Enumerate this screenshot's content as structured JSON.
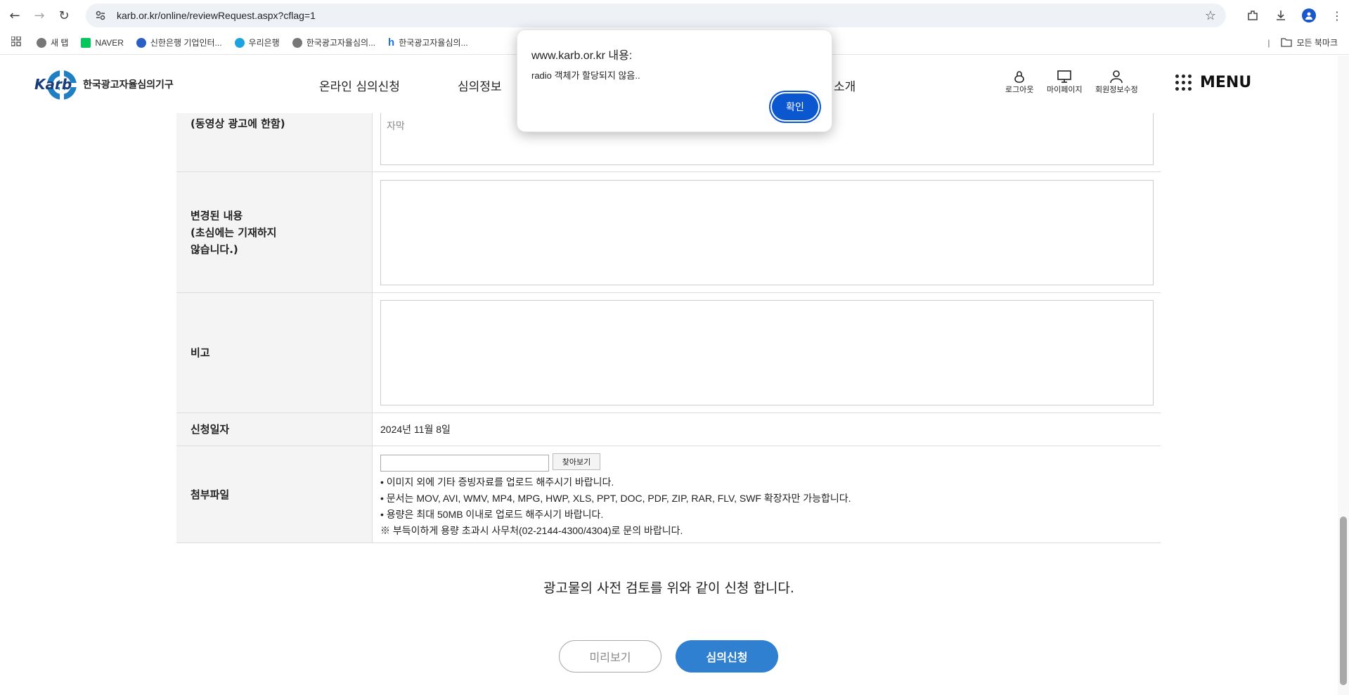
{
  "browser": {
    "url": "karb.or.kr/online/reviewRequest.aspx?cflag=1",
    "bookmarks": [
      {
        "label": "새 탭"
      },
      {
        "label": "NAVER"
      },
      {
        "label": "신한은행 기업인터..."
      },
      {
        "label": "우리은행"
      },
      {
        "label": "한국광고자율심의..."
      },
      {
        "label": "한국광고자율심의..."
      }
    ],
    "bookmarks_folder": "모든 북마크"
  },
  "header": {
    "logo_text": "한국광고자율심의기구",
    "logo_mark": "Karb",
    "nav": [
      "온라인 심의신청",
      "심의정보",
      "소개"
    ],
    "utils": [
      "로그아웃",
      "마이페이지",
      "회원정보수정"
    ],
    "menu_label": "MENU"
  },
  "form": {
    "subtitle_row": {
      "label": "(동영상 광고에 한함)",
      "placeholder": "자막"
    },
    "changed_row": {
      "label_line1": "변경된 내용",
      "label_line2": "(초심에는 기재하지",
      "label_line3": "않습니다.)"
    },
    "remarks_row": {
      "label": "비고"
    },
    "date_row": {
      "label": "신청일자",
      "value": "2024년 11월 8일"
    },
    "file_row": {
      "label": "첨부파일",
      "browse_button": "찾아보기",
      "notes": [
        "• 이미지 외에 기타 증빙자료를 업로드 해주시기 바랍니다.",
        "• 문서는 MOV, AVI, WMV, MP4, MPG, HWP, XLS, PPT, DOC, PDF, ZIP, RAR, FLV, SWF 확장자만 가능합니다.",
        "• 용량은 최대 50MB 이내로 업로드 해주시기 바랍니다.",
        "※ 부득이하게 용량 초과시 사무처(02-2144-4300/4304)로 문의 바랍니다."
      ]
    }
  },
  "confirm_text": "광고물의 사전 검토를 위와 같이 신청 합니다.",
  "buttons": {
    "preview": "미리보기",
    "submit": "심의신청"
  },
  "dialog": {
    "title": "www.karb.or.kr 내용:",
    "message": "radio 객체가 할당되지 않음..",
    "ok": "확인"
  },
  "colors": {
    "accent": "#2f80d1",
    "dialog_button": "#0b57d0",
    "logo_blue": "#1f7fc4"
  }
}
